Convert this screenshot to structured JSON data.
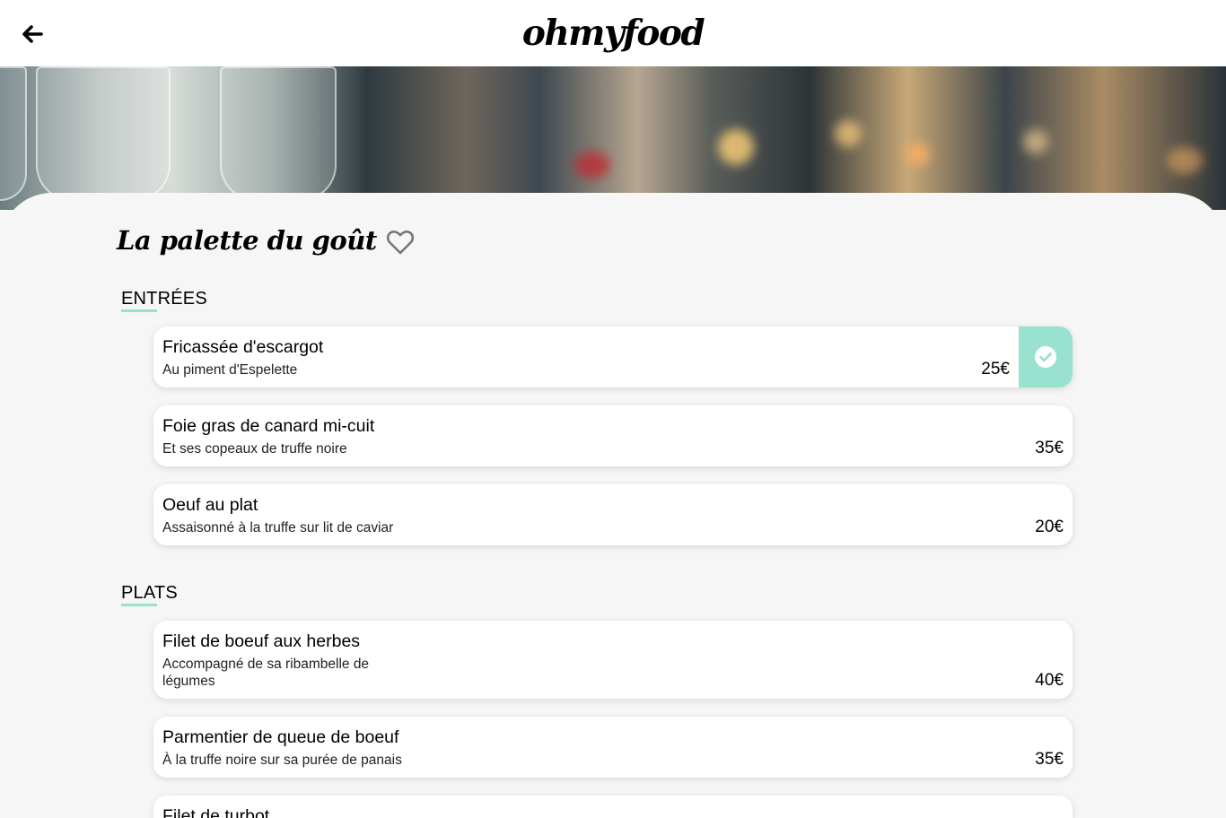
{
  "header": {
    "logo": "ohmyfood",
    "back_icon": "arrow-left-icon"
  },
  "hero": {
    "image": "restaurant-wine-glasses-photo"
  },
  "restaurant": {
    "name": "La palette du goût",
    "like_icon": "heart-outline-icon"
  },
  "sections": [
    {
      "title": "ENTRÉES",
      "dishes": [
        {
          "name": "Fricassée d'escargot",
          "description": "Au piment d'Espelette",
          "price": "25€",
          "selected": true
        },
        {
          "name": "Foie gras de canard mi-cuit",
          "description": "Et ses copeaux de truffe noire",
          "price": "35€",
          "selected": false
        },
        {
          "name": "Oeuf au plat",
          "description": "Assaisonné à la truffe sur lit de caviar",
          "price": "20€",
          "selected": false
        }
      ]
    },
    {
      "title": "PLATS",
      "dishes": [
        {
          "name": "Filet de boeuf aux herbes",
          "description": "Accompagné de sa ribambelle de légumes",
          "price": "40€",
          "selected": false
        },
        {
          "name": "Parmentier de queue de boeuf",
          "description": "À la truffe noire sur sa purée de panais",
          "price": "35€",
          "selected": false
        },
        {
          "name": "Filet de turbot",
          "description": "",
          "price": "",
          "selected": false
        }
      ]
    }
  ],
  "colors": {
    "accent": "#99e2d0",
    "background": "#f6f6f6",
    "card": "#ffffff"
  }
}
